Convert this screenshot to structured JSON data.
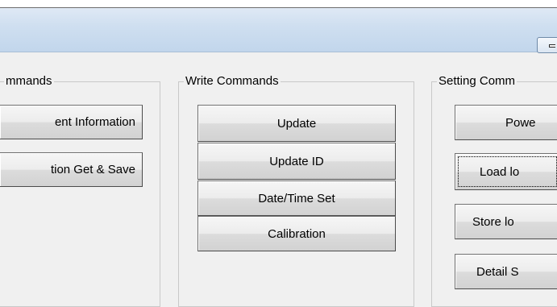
{
  "groups": {
    "read": {
      "label": "mmands",
      "buttons": [
        {
          "label": "ent Information"
        },
        {
          "label": "tion Get & Save"
        }
      ]
    },
    "write": {
      "label": "Write Commands",
      "buttons": [
        {
          "label": "Update"
        },
        {
          "label": "Update ID"
        },
        {
          "label": "Date/Time Set"
        },
        {
          "label": "Calibration"
        }
      ]
    },
    "setting": {
      "label": "Setting Comm",
      "buttons": [
        {
          "label": "Powe"
        },
        {
          "label": "Load lo"
        },
        {
          "label": "Store lo"
        },
        {
          "label": "Detail S"
        }
      ]
    }
  }
}
